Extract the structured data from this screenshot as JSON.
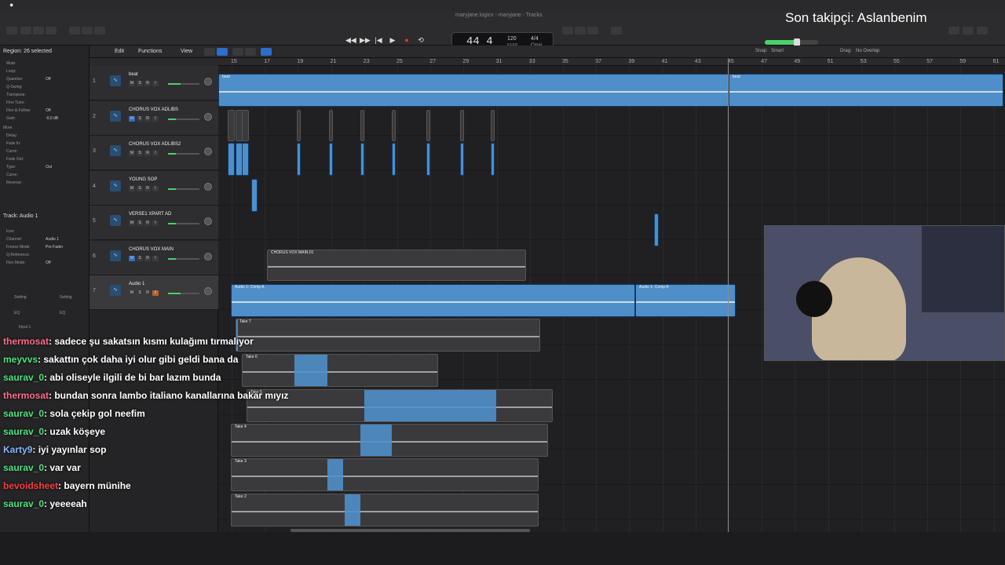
{
  "window": {
    "title": "maryjane.logicx - maryjane - Tracks"
  },
  "transport": {
    "rewind": "◀◀",
    "forward": "▶▶",
    "to_start": "|◀",
    "play": "▶",
    "record": "●",
    "cycle": "⟲"
  },
  "lcd": {
    "position": "44 4",
    "tempo": "120",
    "tempo_label": "KEEP",
    "time_signature": "4/4",
    "key": "Cmaj"
  },
  "overlay": {
    "follower_text": "Son takipçi: Aslanbenim"
  },
  "master": {
    "level": 0.6
  },
  "inspector": {
    "region_title": "Region: 26 selected",
    "region_rows": [
      {
        "label": "Mute:",
        "value": ""
      },
      {
        "label": "Loop:",
        "value": ""
      },
      {
        "label": "Quantize:",
        "value": "Off"
      },
      {
        "label": "Q-Swing:",
        "value": ""
      },
      {
        "label": "Transpose:",
        "value": ""
      },
      {
        "label": "Fine Tune:",
        "value": ""
      },
      {
        "label": "Flex & Follow:",
        "value": "Off"
      },
      {
        "label": "Gain:",
        "value": "-9,0 dB"
      }
    ],
    "more_label": "More",
    "more_rows": [
      {
        "label": "Delay:",
        "value": ""
      },
      {
        "label": "Fade In:",
        "value": ""
      },
      {
        "label": "Curve:",
        "value": ""
      },
      {
        "label": "Fade Out:",
        "value": ""
      },
      {
        "label": "Type:",
        "value": "Out"
      },
      {
        "label": "Curve:",
        "value": ""
      },
      {
        "label": "Reverse:",
        "value": ""
      }
    ],
    "track_title": "Track: Audio 1",
    "track_rows": [
      {
        "label": "Icon:",
        "value": ""
      },
      {
        "label": "Channel:",
        "value": "Audio 1"
      },
      {
        "label": "Freeze Mode:",
        "value": "Pre Fader"
      },
      {
        "label": "Q-Reference:",
        "value": ""
      },
      {
        "label": "Flex Mode:",
        "value": "Off"
      }
    ],
    "bottom_labels": [
      "Setting",
      "Setting",
      "EQ",
      "EQ",
      "Input 1"
    ]
  },
  "localbar": {
    "edit": "Edit",
    "functions": "Functions",
    "view": "View",
    "snap_label": "Snap:",
    "snap_value": "Smart",
    "drag_label": "Drag:",
    "drag_value": "No Overlap"
  },
  "ruler": [
    "15",
    "17",
    "19",
    "21",
    "23",
    "25",
    "27",
    "29",
    "31",
    "33",
    "35",
    "37",
    "39",
    "41",
    "43",
    "45",
    "47",
    "49",
    "51",
    "53",
    "55",
    "57",
    "59",
    "61"
  ],
  "tracks": [
    {
      "num": "1",
      "name": "beat",
      "sel": false
    },
    {
      "num": "2",
      "name": "CHORUS VOX ADLIBS",
      "sel": false
    },
    {
      "num": "3",
      "name": "CHORUS VOX ADLIBS2",
      "sel": false
    },
    {
      "num": "4",
      "name": "YOUNG SOP",
      "sel": false
    },
    {
      "num": "5",
      "name": "VERSE1 XPART AD",
      "sel": false
    },
    {
      "num": "6",
      "name": "CHORUS VOX MAIN",
      "sel": false
    },
    {
      "num": "7",
      "name": "Audio 1",
      "sel": true
    }
  ],
  "regions": {
    "beat_a": "beat",
    "beat_b": "beat",
    "chorus_main": "CHORUS VOX MAIN.01",
    "comp_a": "Audio 1: Comp A",
    "comp_b": "Audio 1: Comp A",
    "takes": [
      "Take 7",
      "Take 6",
      "Take 5",
      "Take 4",
      "Take 3",
      "Take 2"
    ]
  },
  "chat": [
    {
      "user": "thermosat",
      "text": ": sadece şu sakatsın kısmı kulağımı tırmalıyor",
      "color": "#ff6b8a"
    },
    {
      "user": "meyvvs",
      "text": ": sakattın çok daha iyi olur gibi geldi bana da",
      "color": "#4be37a"
    },
    {
      "user": "saurav_0",
      "text": ": abi oliseyle ilgili de bi bar lazım bunda",
      "color": "#4be37a"
    },
    {
      "user": "thermosat",
      "text": ": bundan sonra lambo italiano kanallarına bakar mıyız",
      "color": "#ff6b8a"
    },
    {
      "user": "saurav_0",
      "text": ": sola çekip gol neefim",
      "color": "#4be37a"
    },
    {
      "user": "saurav_0",
      "text": ": uzak köşeye",
      "color": "#4be37a"
    },
    {
      "user": "Karty9",
      "text": ": iyi yayınlar sop",
      "color": "#8ab4ff"
    },
    {
      "user": "saurav_0",
      "text": ": var var",
      "color": "#4be37a"
    },
    {
      "user": "bevoidsheet",
      "text": ": bayern münihe",
      "color": "#ff3b3b"
    },
    {
      "user": "saurav_0",
      "text": ": yeeeeah",
      "color": "#4be37a"
    }
  ]
}
